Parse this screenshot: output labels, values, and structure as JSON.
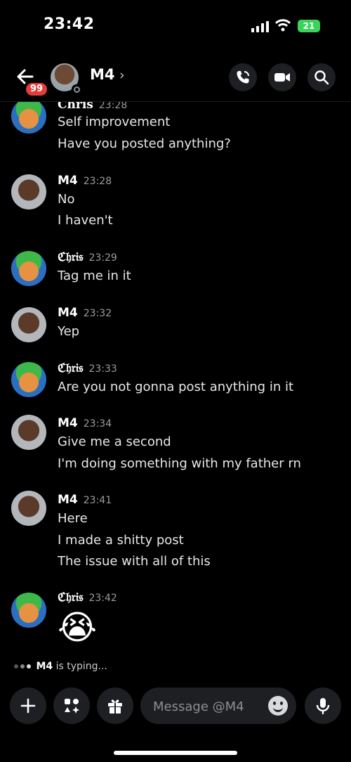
{
  "status_bar": {
    "time": "23:42",
    "battery": "21"
  },
  "header": {
    "badge": "99",
    "title": "M4",
    "chevron": "›"
  },
  "messages": [
    {
      "author": "Chris",
      "time": "23:28",
      "lines": [
        "Self improvement",
        "Have you posted anything?"
      ]
    },
    {
      "author": "M4",
      "time": "23:28",
      "lines": [
        "No",
        "I haven't"
      ]
    },
    {
      "author": "ℭ𝔥𝔯𝔦𝔰",
      "time": "23:29",
      "lines": [
        "Tag me in it"
      ]
    },
    {
      "author": "M4",
      "time": "23:32",
      "lines": [
        "Yep"
      ]
    },
    {
      "author": "ℭ𝔥𝔯𝔦𝔰",
      "time": "23:33",
      "lines": [
        "Are you not gonna post anything in it"
      ]
    },
    {
      "author": "M4",
      "time": "23:34",
      "lines": [
        "Give me a second",
        "I'm doing something with my father rn"
      ]
    },
    {
      "author": "M4",
      "time": "23:41",
      "lines": [
        "Here",
        "I made a shitty post",
        "The issue with all of this"
      ]
    },
    {
      "author": "ℭ𝔥𝔯𝔦𝔰",
      "time": "23:42",
      "lines": [
        "😭"
      ]
    }
  ],
  "typing": {
    "name": "M4",
    "suffix": " is typing..."
  },
  "composer": {
    "placeholder": "Message @M4"
  },
  "colors": {
    "background": "#000000",
    "button_bg": "#1e1f22",
    "badge": "#e23d3d",
    "battery": "#3bd45a",
    "timestamp": "#9b9ba3"
  },
  "icons": [
    "back-arrow-icon",
    "phone-call-icon",
    "video-camera-icon",
    "search-icon",
    "plus-icon",
    "apps-icon",
    "gift-icon",
    "emoji-icon",
    "microphone-icon"
  ]
}
